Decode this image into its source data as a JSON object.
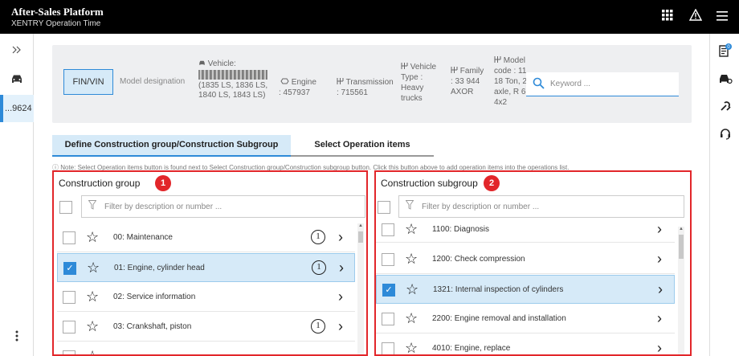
{
  "header": {
    "title": "After-Sales Platform",
    "subtitle": "XENTRY Operation Time",
    "icons": [
      "apps-grid-icon",
      "warning-icon",
      "menu-icon"
    ]
  },
  "leftrail": {
    "vin_tab": "...9624"
  },
  "rightrail": {
    "notification_count": "0"
  },
  "infobar": {
    "fin_vin_button": "FIN/VIN",
    "model_designation": "Model designation",
    "vehicle_label": "Vehicle:",
    "vehicle_models": "(1835 LS, 1836 LS, 1840 LS, 1843 LS)",
    "engine_label": "Engine",
    "engine_value": ": 457937",
    "transmission_label": "Transmission",
    "transmission_value": ": 715561",
    "vehicle_type_label": "Vehicle Type :",
    "vehicle_type_value": "Heavy trucks",
    "family_label": "Family",
    "family_value": ": 33 944 AXOR",
    "model_code_label": "Model code : 11",
    "model_code_value": "18 Ton, 2-axle, R 6, 4x2",
    "search_placeholder": "Keyword ..."
  },
  "tabs": {
    "define": "Define Construction group/Construction Subgroup",
    "select": "Select Operation items"
  },
  "note": "ⓘ Note: Select Operation items button is found next to Select Construction group/Construction subgroup button. Click this button above to add operation items into the operations list.",
  "construction_group": {
    "title": "Construction group",
    "badge": "1",
    "filter_placeholder": "Filter by description or number ...",
    "items": [
      {
        "label": "00: Maintenance",
        "selected": false,
        "info": true
      },
      {
        "label": "01: Engine, cylinder head",
        "selected": true,
        "info": true
      },
      {
        "label": "02: Service information",
        "selected": false,
        "info": false
      },
      {
        "label": "03: Crankshaft, piston",
        "selected": false,
        "info": true
      }
    ]
  },
  "construction_subgroup": {
    "title": "Construction subgroup",
    "badge": "2",
    "filter_placeholder": "Filter by description or number ...",
    "items": [
      {
        "label": "1100: Diagnosis",
        "selected": false
      },
      {
        "label": "1200: Check compression",
        "selected": false
      },
      {
        "label": "1321: Internal inspection of cylinders",
        "selected": true
      },
      {
        "label": "2200: Engine removal and installation",
        "selected": false
      },
      {
        "label": "4010: Engine, replace",
        "selected": false
      }
    ]
  },
  "colors": {
    "accent": "#2e8ad8",
    "selected_bg": "#d6eaf8",
    "highlight_red": "#e2262a"
  }
}
